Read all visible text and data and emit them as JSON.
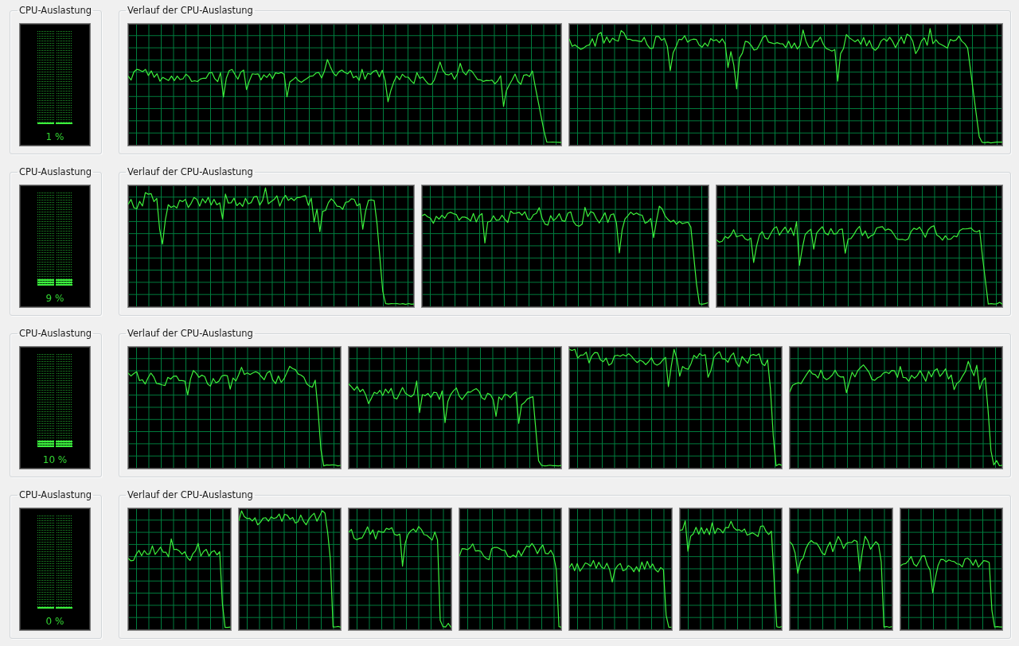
{
  "rows": [
    {
      "usage": {
        "title": "CPU-Auslastung",
        "level": 0.01,
        "reading": "1 %"
      },
      "history": {
        "title": "Verlauf der CPU-Auslastung",
        "graphs": [
          {
            "kind": "line"
          },
          {
            "kind": "line"
          }
        ]
      }
    },
    {
      "usage": {
        "title": "CPU-Auslastung",
        "level": 0.09,
        "reading": "9 %"
      },
      "history": {
        "title": "Verlauf der CPU-Auslastung",
        "graphs": [
          {
            "kind": "line"
          },
          {
            "kind": "line"
          },
          {
            "kind": "line"
          }
        ]
      }
    },
    {
      "usage": {
        "title": "CPU-Auslastung",
        "level": 0.1,
        "reading": "10 %"
      },
      "history": {
        "title": "Verlauf der CPU-Auslastung",
        "graphs": [
          {
            "kind": "line"
          },
          {
            "kind": "line"
          },
          {
            "kind": "line"
          },
          {
            "kind": "line"
          }
        ]
      }
    },
    {
      "usage": {
        "title": "CPU-Auslastung",
        "level": 0,
        "reading": "0 %"
      },
      "history": {
        "title": "Verlauf der CPU-Auslastung",
        "graphs": [
          {
            "kind": "line"
          },
          {
            "kind": "line"
          },
          {
            "kind": "line"
          },
          {
            "kind": "line"
          },
          {
            "kind": "line"
          },
          {
            "kind": "line"
          },
          {
            "kind": "line"
          },
          {
            "kind": "line"
          }
        ]
      }
    }
  ]
}
